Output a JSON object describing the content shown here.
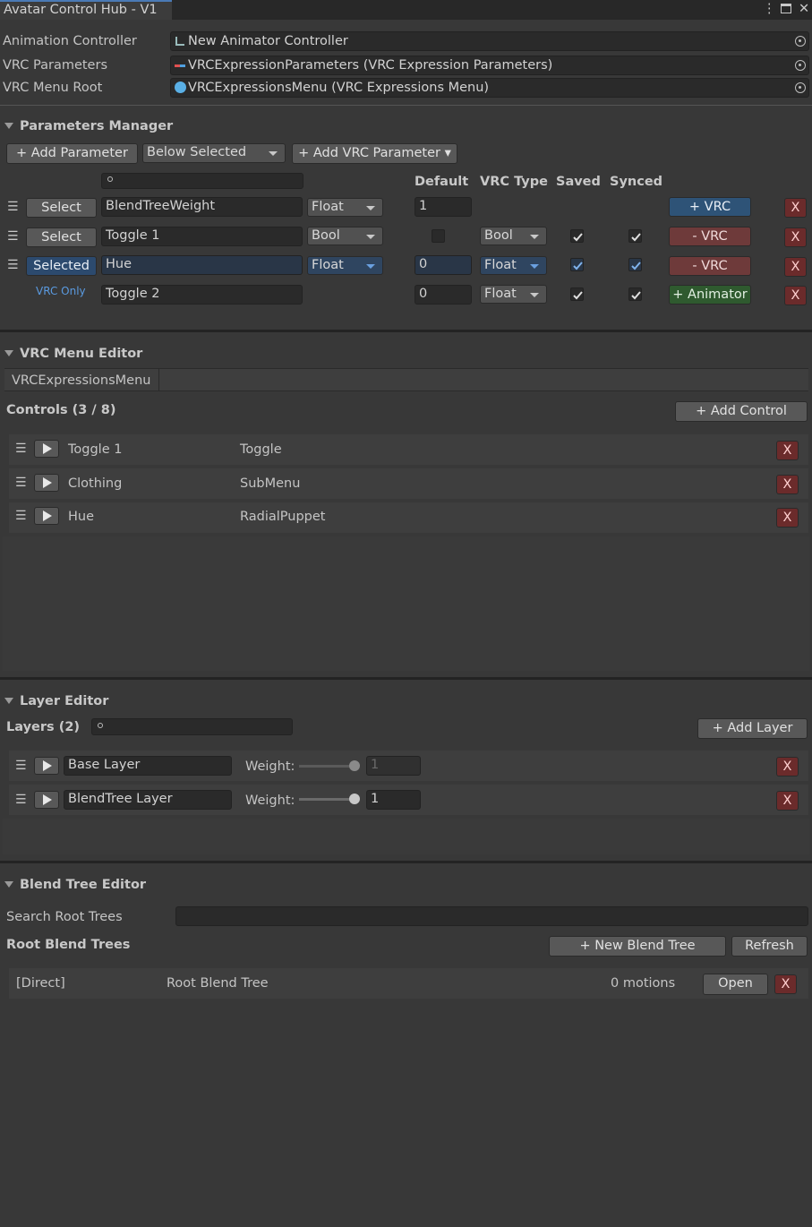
{
  "window": {
    "title": "Avatar Control Hub - V1",
    "menu_glyph": "⋮",
    "maximize_glyph": "🗖",
    "close_glyph": "✕"
  },
  "refs": {
    "anim_controller_label": "Animation Controller",
    "anim_controller_value": "New Animator Controller",
    "vrc_params_label": "VRC Parameters",
    "vrc_params_value": "VRCExpressionParameters (VRC Expression Parameters)",
    "vrc_menu_label": "VRC Menu Root",
    "vrc_menu_value": "VRCExpressionsMenu (VRC Expressions Menu)"
  },
  "params": {
    "title": "Parameters Manager",
    "add_param": "+ Add Parameter",
    "insert_mode": "Below Selected",
    "add_vrc_param": "+ Add VRC Parameter ▾",
    "col_default": "Default",
    "col_vrc_type": "VRC Type",
    "col_saved": "Saved",
    "col_synced": "Synced",
    "rows": [
      {
        "select": "Select",
        "name": "BlendTreeWeight",
        "type": "Float",
        "default": "1",
        "vrc_type": "",
        "saved": false,
        "synced": false,
        "action": "+ VRC"
      },
      {
        "select": "Select",
        "name": "Toggle 1",
        "type": "Bool",
        "default": "",
        "vrc_type": "Bool",
        "saved": true,
        "synced": true,
        "action": "- VRC"
      },
      {
        "select": "Selected",
        "name": "Hue",
        "type": "Float",
        "default": "0",
        "vrc_type": "Float",
        "saved": true,
        "synced": true,
        "action": "- VRC"
      },
      {
        "select": "VRC Only",
        "name": "Toggle 2",
        "type": "",
        "default": "0",
        "vrc_type": "Float",
        "saved": true,
        "synced": true,
        "action": "+ Animator"
      }
    ],
    "delete": "X"
  },
  "menu": {
    "title": "VRC Menu Editor",
    "tab": "VRCExpressionsMenu",
    "controls_label": "Controls (3 / 8)",
    "add_control": "+ Add Control",
    "controls": [
      {
        "name": "Toggle 1",
        "type": "Toggle"
      },
      {
        "name": "Clothing",
        "type": "SubMenu"
      },
      {
        "name": "Hue",
        "type": "RadialPuppet"
      }
    ]
  },
  "layers": {
    "title": "Layer Editor",
    "count_label": "Layers (2)",
    "add_layer": "+ Add Layer",
    "weight_label": "Weight:",
    "items": [
      {
        "name": "Base Layer",
        "weight": "1",
        "weight_fraction": 1.0
      },
      {
        "name": "BlendTree Layer",
        "weight": "1",
        "weight_fraction": 1.0
      }
    ]
  },
  "blend": {
    "title": "Blend Tree Editor",
    "search_label": "Search Root Trees",
    "root_label": "Root Blend Trees",
    "new_tree": "+ New Blend Tree",
    "refresh": "Refresh",
    "trees": [
      {
        "kind": "[Direct]",
        "name": "Root Blend Tree",
        "motions": "0 motions",
        "open": "Open"
      }
    ]
  },
  "colors": {
    "bg": "#383838",
    "field": "#2a2a2a",
    "accent_blue": "#4a7ab5",
    "delete_red": "#6b2b2b",
    "add_vrc": "#2e5377",
    "remove_vrc": "#6e3a3a",
    "add_animator": "#2f5a2f"
  }
}
